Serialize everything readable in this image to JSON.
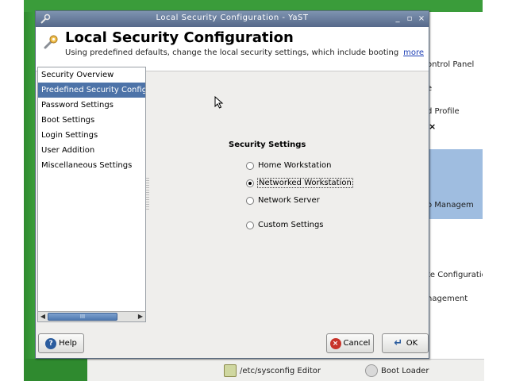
{
  "window": {
    "title": "Local Security Configuration - YaST",
    "controls": [
      "_",
      "▫",
      "×"
    ]
  },
  "header": {
    "title": "Local Security Configuration",
    "description": "Using predefined defaults, change the local security settings, which include booting, l...",
    "more_link": "more"
  },
  "nav": {
    "items": [
      {
        "label": "Security Overview",
        "selected": false
      },
      {
        "label": "Predefined Security Configurations",
        "selected": true
      },
      {
        "label": "Password Settings",
        "selected": false
      },
      {
        "label": "Boot Settings",
        "selected": false
      },
      {
        "label": "Login Settings",
        "selected": false
      },
      {
        "label": "User Addition",
        "selected": false
      },
      {
        "label": "Miscellaneous Settings",
        "selected": false
      }
    ],
    "scroll_grip": "III"
  },
  "security_settings": {
    "title": "Security Settings",
    "options": [
      {
        "label": "Home Workstation",
        "selected": false
      },
      {
        "label": "Networked Workstation",
        "selected": true
      },
      {
        "label": "Network Server",
        "selected": false
      },
      {
        "label": "Custom Settings",
        "selected": false
      }
    ]
  },
  "buttons": {
    "help": "Help",
    "cancel": "Cancel",
    "ok": "OK"
  },
  "background_window": {
    "labels": [
      "ontrol Panel",
      "e",
      "d Profile",
      "o Managem",
      "te Configuratio",
      "nagement"
    ],
    "bottom_items": [
      "/etc/sysconfig Editor",
      "Boot Loader"
    ]
  },
  "colors": {
    "selection": "#4d73a8",
    "titlebar": "#6a7f9e",
    "link": "#1d3fb5"
  }
}
